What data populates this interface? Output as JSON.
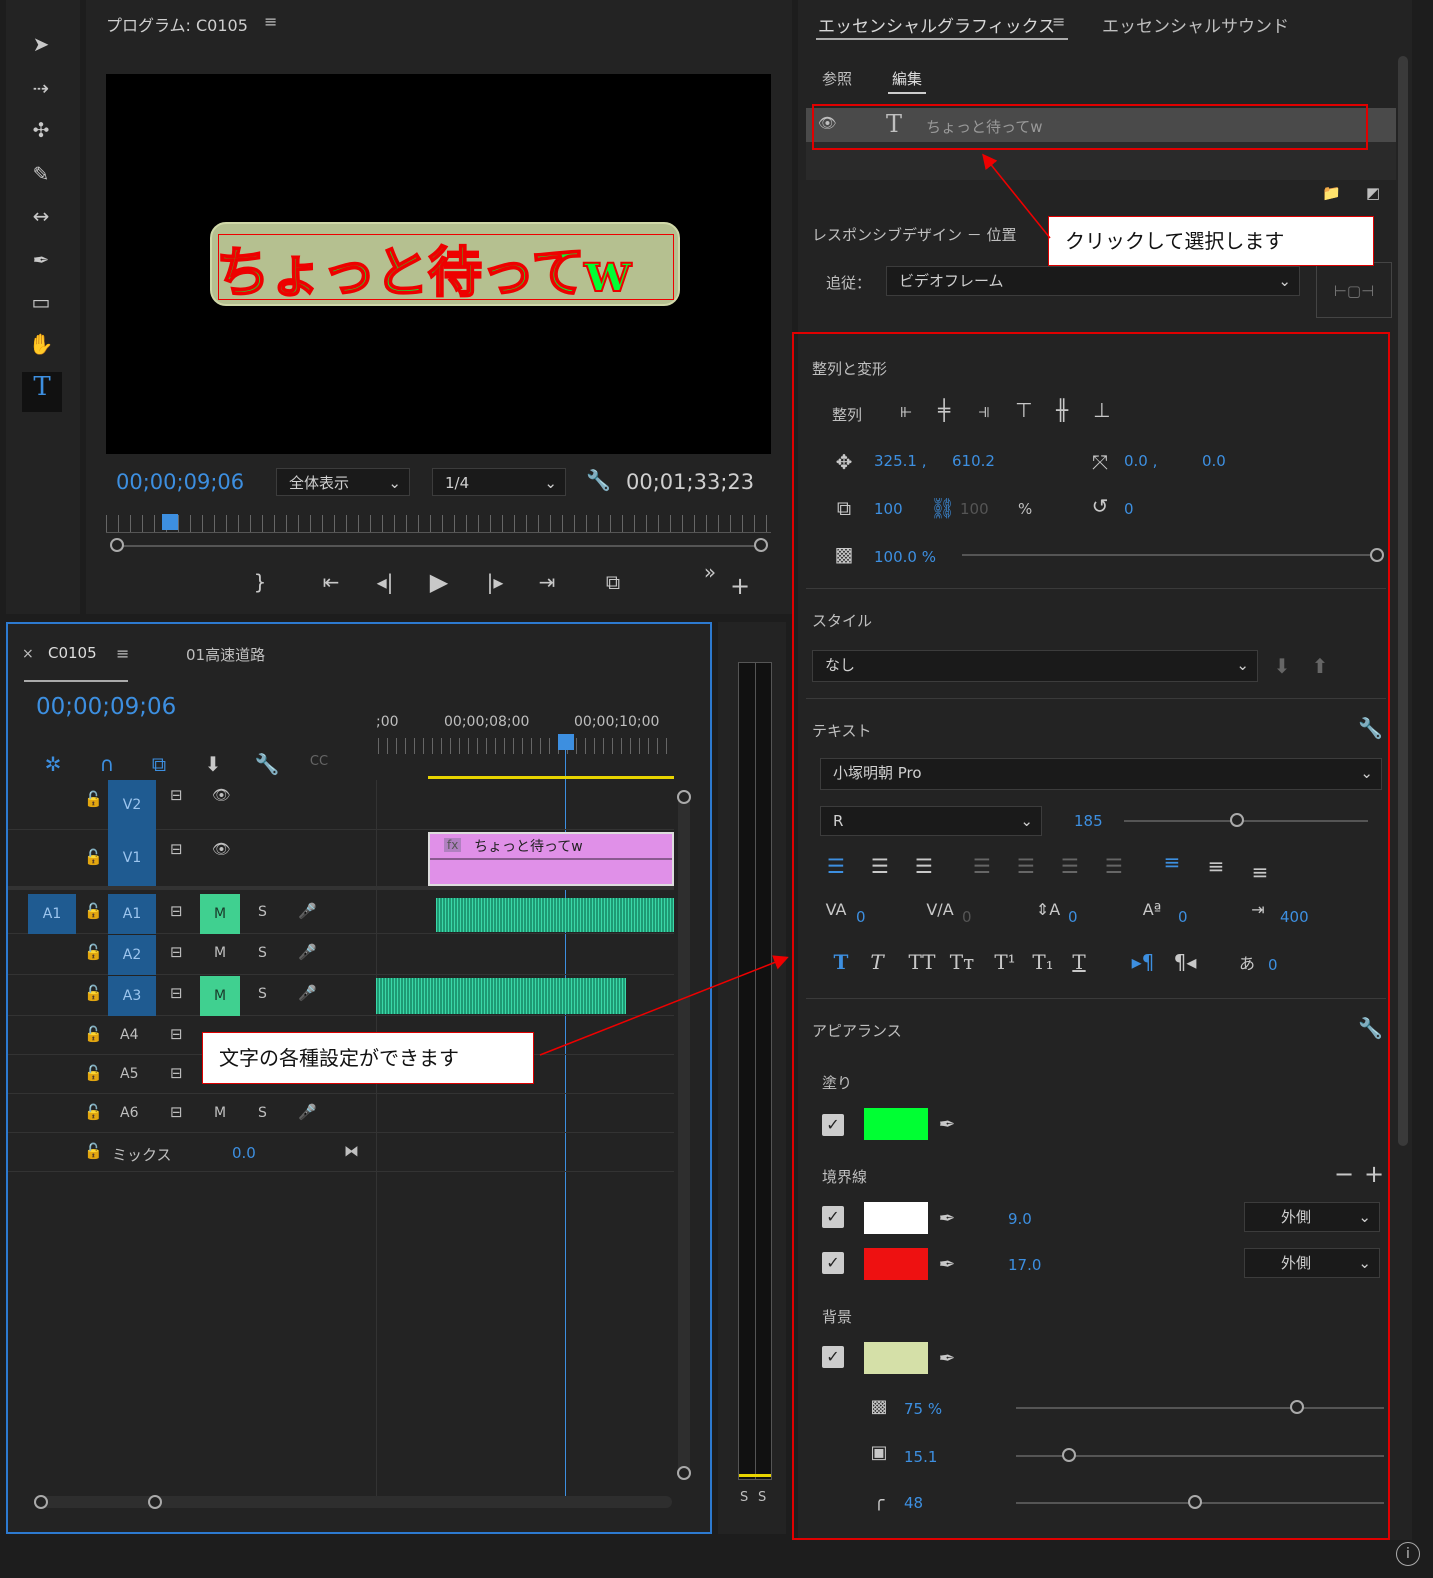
{
  "program": {
    "title": "プログラム: C0105",
    "overlay_text": "ちょっと待ってw",
    "timecode": "00;00;09;06",
    "zoom": "全体表示",
    "resolution": "1/4",
    "duration": "00;01;33;23"
  },
  "essential": {
    "tab_graphics": "エッセンシャルグラフィックス",
    "tab_sound": "エッセンシャルサウンド",
    "sub_browse": "参照",
    "sub_edit": "編集",
    "layer_name": "ちょっと待ってw",
    "responsive_label": "レスポンシブデザイン － 位置",
    "follow_label": "追従：",
    "follow_value": "ビデオフレーム",
    "align_title": "整列と変形",
    "align_label": "整列",
    "pos_x": "325.1 ,",
    "pos_y": "610.2",
    "anchor_x": "0.0 ,",
    "anchor_y": "0.0",
    "scale": "100",
    "scale_h": "100",
    "percent": "%",
    "rotation": "0",
    "opacity": "100.0 %",
    "style_title": "スタイル",
    "style_value": "なし",
    "text_title": "テキスト",
    "font": "小塚明朝 Pro",
    "font_style": "R",
    "font_size": "185",
    "kerning": "0",
    "tracking": "0",
    "leading": "0",
    "baseline": "0",
    "tab_width": "400",
    "tsume": "0",
    "appearance_title": "アピアランス",
    "fill_label": "塗り",
    "fill_color": "#00ff33",
    "stroke_label": "境界線",
    "stroke1_color": "#ffffff",
    "stroke1_width": "9.0",
    "stroke1_pos": "外側",
    "stroke2_color": "#ee1111",
    "stroke2_width": "17.0",
    "stroke2_pos": "外側",
    "bg_label": "背景",
    "bg_color": "#d5e0a8",
    "bg_opacity": "75 %",
    "bg_size": "15.1",
    "bg_radius": "48"
  },
  "timeline": {
    "tab_active": "C0105",
    "tab_other": "01高速道路",
    "timecode": "00;00;09;06",
    "ruler": [
      ";00",
      "00;00;08;00",
      "00;00;10;00"
    ],
    "tracks_video": [
      "V2",
      "V1"
    ],
    "tracks_audio": [
      "A1",
      "A2",
      "A3",
      "A4",
      "A5",
      "A6"
    ],
    "src_a1": "A1",
    "mute": "M",
    "solo": "S",
    "mix_label": "ミックス",
    "mix_value": "0.0",
    "clip_label": "ちょっと待ってw",
    "fx": "fx"
  },
  "meter": {
    "s1": "S",
    "s2": "S"
  },
  "callouts": {
    "click": "クリックして選択します",
    "settings": "文字の各種設定ができます"
  }
}
